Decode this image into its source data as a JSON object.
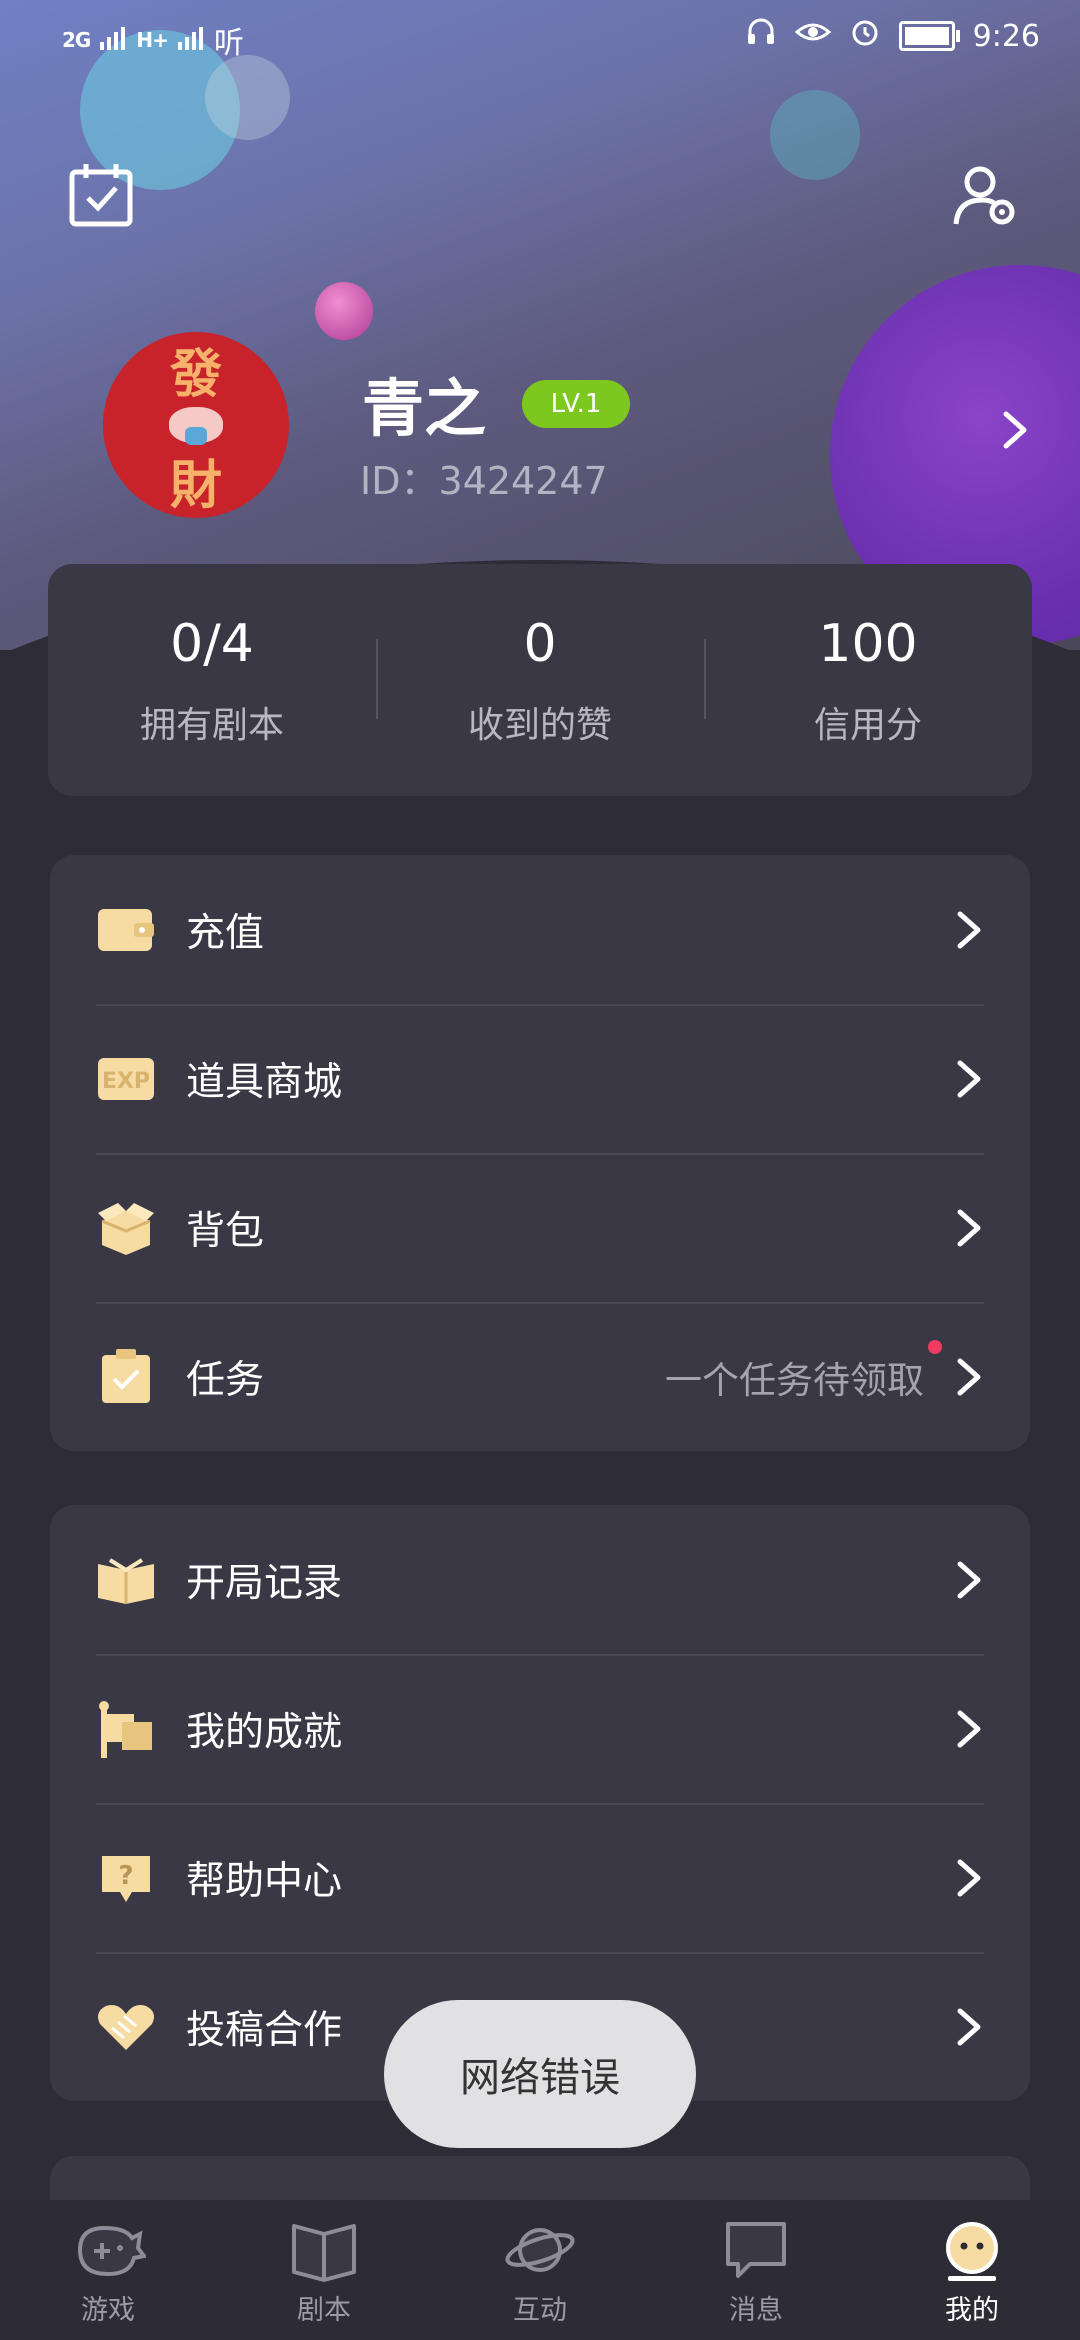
{
  "status_bar": {
    "signal1": "2G",
    "signal2": "H+",
    "carrier": "听",
    "time": "9:26"
  },
  "profile": {
    "name": "青之",
    "level": "LV.1",
    "id_label": "ID：3424247",
    "avatar_text_top": "發",
    "avatar_text_bottom": "財"
  },
  "stats": [
    {
      "value": "0/4",
      "label": "拥有剧本"
    },
    {
      "value": "0",
      "label": "收到的赞"
    },
    {
      "value": "100",
      "label": "信用分"
    }
  ],
  "menu1": [
    {
      "label": "充值",
      "icon": "wallet-icon"
    },
    {
      "label": "道具商城",
      "icon": "exp-card-icon"
    },
    {
      "label": "背包",
      "icon": "box-icon"
    },
    {
      "label": "任务",
      "icon": "task-icon",
      "hint": "一个任务待领取"
    }
  ],
  "menu2": [
    {
      "label": "开局记录",
      "icon": "book-icon"
    },
    {
      "label": "我的成就",
      "icon": "flag-icon"
    },
    {
      "label": "帮助中心",
      "icon": "help-icon"
    },
    {
      "label": "投稿合作",
      "icon": "handshake-icon"
    }
  ],
  "toast": "网络错误",
  "nav": [
    {
      "label": "游戏",
      "icon": "gamepad-icon"
    },
    {
      "label": "剧本",
      "icon": "book-open-icon"
    },
    {
      "label": "互动",
      "icon": "planet-icon"
    },
    {
      "label": "消息",
      "icon": "chat-icon"
    },
    {
      "label": "我的",
      "icon": "face-icon",
      "active": true
    }
  ],
  "colors": {
    "background": "#2e2c36",
    "card": "#3a3844",
    "level_badge": "#7dc81e",
    "icon_gold": "#f6dca2",
    "notification_dot": "#f03a5f"
  }
}
